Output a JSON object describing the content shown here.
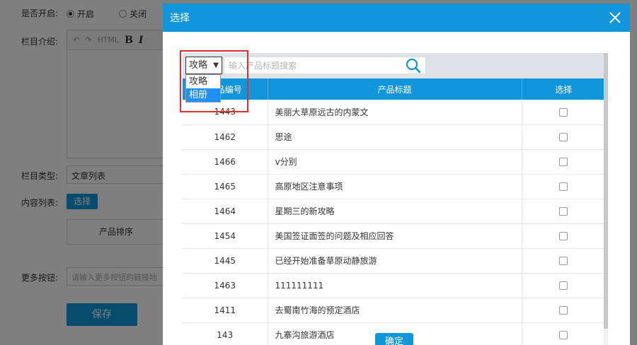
{
  "form": {
    "open_label": "是否开启:",
    "open_on": "开启",
    "open_off": "关闭",
    "intro_label": "栏目介绍:",
    "editor_html": "HTML",
    "editor_bold": "B",
    "editor_italic": "I",
    "type_label": "栏目类型:",
    "type_value": "文章列表",
    "content_label": "内容列表:",
    "content_choose": "选择",
    "sort_label": "产品排序",
    "more_label": "更多按钮:",
    "more_placeholder": "请输入更多按钮的链接地",
    "save": "保存"
  },
  "modal": {
    "title": "选择",
    "type_selected": "攻略",
    "type_options": [
      "攻略",
      "相册"
    ],
    "search_placeholder": "输入产品标题搜索",
    "columns": [
      "产品编号",
      "产品标题",
      "选择"
    ],
    "rows": [
      {
        "id": "1443",
        "title": "美丽大草原远古的内蒙文"
      },
      {
        "id": "1462",
        "title": "思途"
      },
      {
        "id": "1466",
        "title": "v分别"
      },
      {
        "id": "1465",
        "title": "高原地区注意事项"
      },
      {
        "id": "1464",
        "title": "星期三的新攻略"
      },
      {
        "id": "1454",
        "title": "美国签证面签的问题及相应回答"
      },
      {
        "id": "1445",
        "title": "已经开始准备草原动静旅游"
      },
      {
        "id": "1463",
        "title": "111111111"
      },
      {
        "id": "1411",
        "title": "去蜀南竹海的预定酒店"
      },
      {
        "id": "143",
        "title": "九寨沟旅游酒店"
      }
    ],
    "confirm": "确定"
  },
  "colors": {
    "primary": "#1296db",
    "highlight": "#e0302c",
    "option_hl": "#1e90ff"
  }
}
